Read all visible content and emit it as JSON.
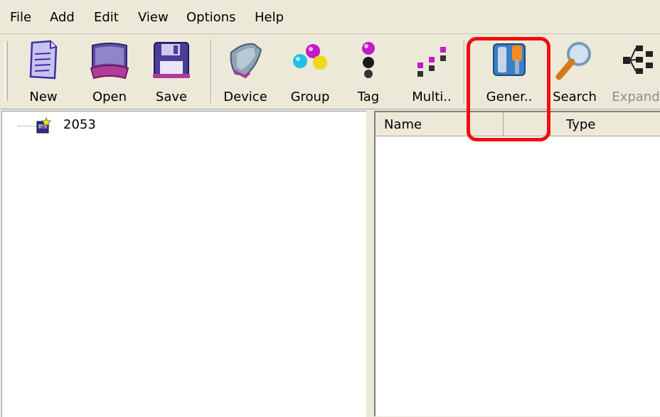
{
  "menu": {
    "file": "File",
    "add": "Add",
    "edit": "Edit",
    "view": "View",
    "options": "Options",
    "help": "Help"
  },
  "toolbar": {
    "new": {
      "label": "New",
      "icon": "document-icon"
    },
    "open": {
      "label": "Open",
      "icon": "open-folder-icon"
    },
    "save": {
      "label": "Save",
      "icon": "floppy-disk-icon"
    },
    "device": {
      "label": "Device",
      "icon": "device-module-icon"
    },
    "group": {
      "label": "Group",
      "icon": "group-balls-icon"
    },
    "tag": {
      "label": "Tag",
      "icon": "tag-balls-icon"
    },
    "multi": {
      "label": "Multi..",
      "icon": "multi-tags-icon"
    },
    "general": {
      "label": "Gener..",
      "icon": "tools-icon"
    },
    "search": {
      "label": "Search",
      "icon": "magnifier-icon"
    },
    "expand": {
      "label": "Expand",
      "icon": "tree-expand-icon",
      "disabled": true
    }
  },
  "tree": {
    "root": {
      "label": "2053",
      "icon": "project-icon"
    }
  },
  "list": {
    "columns": [
      "Name",
      "",
      "Type"
    ]
  },
  "colors": {
    "background": "#ece9d8",
    "highlight": "#f10d0d",
    "pane": "#ffffff"
  }
}
